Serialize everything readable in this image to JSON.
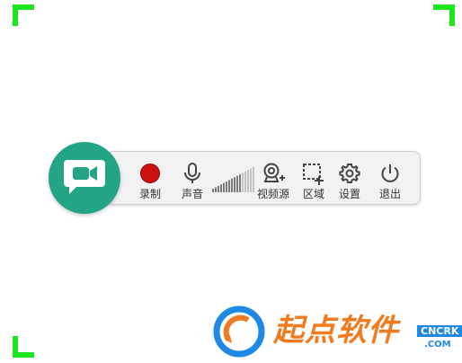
{
  "colors": {
    "frame_corner": "#1ee61e",
    "camera_badge": "#23a487",
    "record_dot": "#cc1111",
    "toolbar_bg": "#f2f2f2",
    "watermark_orange": "#f07a1e",
    "watermark_blue": "#1e88e5"
  },
  "toolbar": {
    "record_label": "录制",
    "audio_label": "声音",
    "audio_volume_level": 0.72,
    "video_source_label": "视频源",
    "region_label": "区域",
    "settings_label": "设置",
    "exit_label": "退出"
  },
  "watermark": {
    "text": "起点软件",
    "tag1": "CNCRK",
    "tag2": ".COM"
  }
}
